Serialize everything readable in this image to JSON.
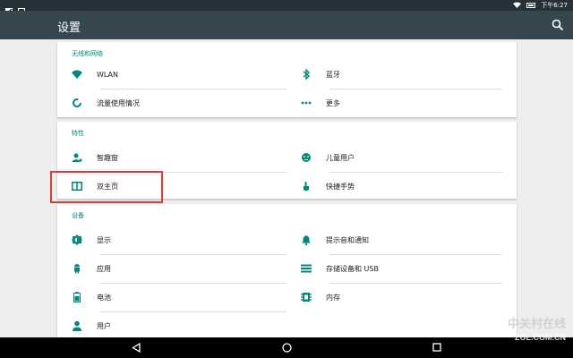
{
  "status": {
    "time": "下午6:27"
  },
  "appbar": {
    "title": "设置"
  },
  "sections": {
    "wireless": {
      "title": "无线和网络",
      "items": [
        {
          "label": "WLAN",
          "icon": "wifi-icon"
        },
        {
          "label": "蓝牙",
          "icon": "bluetooth-icon"
        },
        {
          "label": "流量使用情况",
          "icon": "data-usage-icon"
        },
        {
          "label": "更多",
          "icon": "more-icon"
        }
      ]
    },
    "features": {
      "title": "特性",
      "items": [
        {
          "label": "智趣窗",
          "icon": "smart-window-icon"
        },
        {
          "label": "儿童用户",
          "icon": "child-user-icon"
        },
        {
          "label": "双主页",
          "icon": "dual-home-icon"
        },
        {
          "label": "快捷手势",
          "icon": "gesture-icon"
        }
      ]
    },
    "device": {
      "title": "设备",
      "items": [
        {
          "label": "显示",
          "icon": "display-icon"
        },
        {
          "label": "提示音和通知",
          "icon": "notification-bell-icon"
        },
        {
          "label": "应用",
          "icon": "android-icon"
        },
        {
          "label": "存储设备和 USB",
          "icon": "storage-icon"
        },
        {
          "label": "电池",
          "icon": "battery-icon"
        },
        {
          "label": "内存",
          "icon": "memory-icon"
        },
        {
          "label": "用户",
          "icon": "user-icon"
        }
      ]
    }
  },
  "watermark": {
    "text": "ZOL.COM.CN",
    "sub": "中关村在线"
  },
  "colors": {
    "accent": "#00897b",
    "appbar": "#37474f",
    "statusbar": "#263238",
    "highlight": "#e53935"
  }
}
